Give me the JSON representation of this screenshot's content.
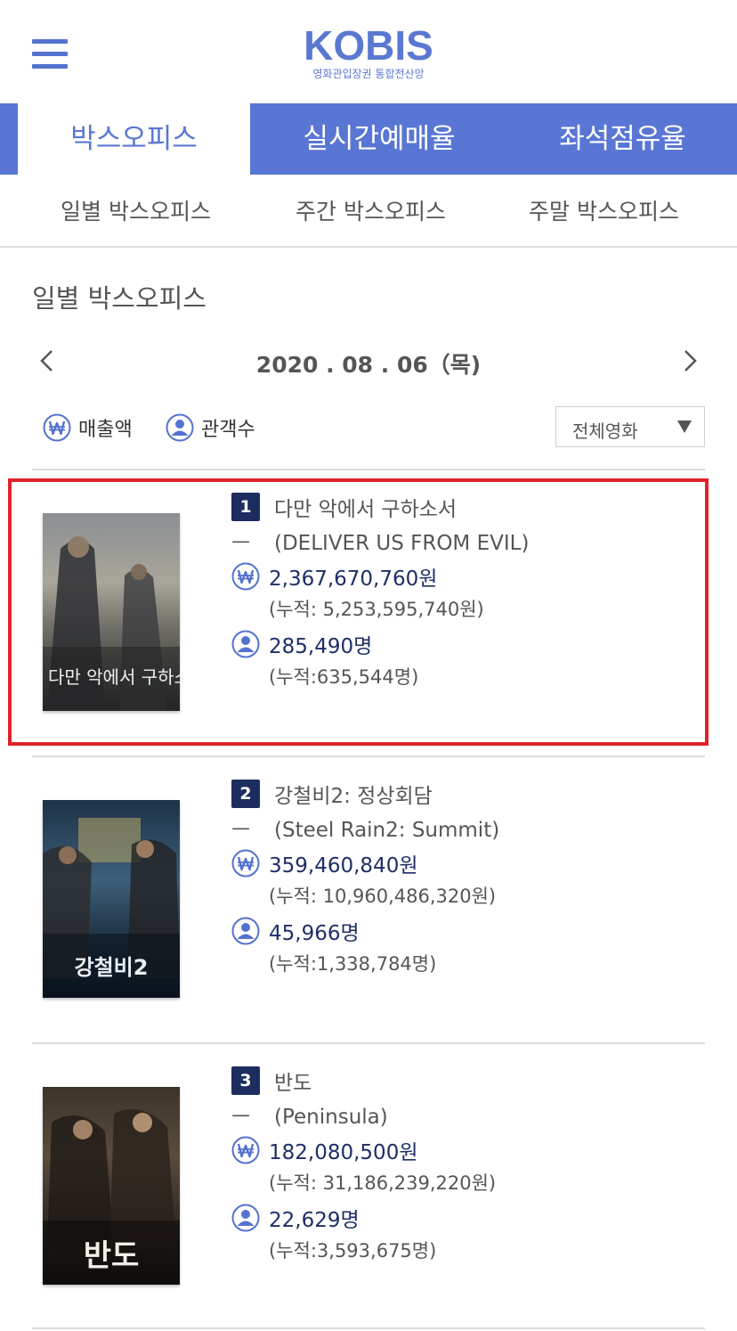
{
  "header": {
    "logo_title": "KOBIS",
    "logo_subtitle": "영화관입장권 통합전산망",
    "menu_icon": "hamburger-menu-icon"
  },
  "main_tabs": [
    {
      "label": "박스오피스",
      "active": true
    },
    {
      "label": "실시간예매율",
      "active": false
    },
    {
      "label": "좌석점유율",
      "active": false
    }
  ],
  "sub_tabs": [
    {
      "label": "일별 박스오피스"
    },
    {
      "label": "주간 박스오피스"
    },
    {
      "label": "주말 박스오피스"
    }
  ],
  "section_title": "일별 박스오피스",
  "date_nav": {
    "date": "2020 . 08 . 06（목)",
    "prev_icon": "chevron-left-icon",
    "next_icon": "chevron-right-icon"
  },
  "toggles": {
    "sales_label": "매출액",
    "audience_label": "관객수"
  },
  "filter": {
    "selected": "전체영화"
  },
  "colors": {
    "brand": "#5976d4",
    "navy": "#1d2d5f",
    "highlight": "#e0222a"
  },
  "movies": [
    {
      "rank": "1",
      "title_ko": "다만 악에서 구하소서",
      "dash": "ㅡ",
      "title_en": "(DELIVER US FROM EVIL)",
      "sales": "2,367,670,760원",
      "sales_cum": "(누적: 5,253,595,740원)",
      "audience": "285,490명",
      "audience_cum": "(누적:635,544명)",
      "poster_text": "다만 악에서 구하소서"
    },
    {
      "rank": "2",
      "title_ko": "강철비2: 정상회담",
      "dash": "ㅡ",
      "title_en": "(Steel Rain2: Summit)",
      "sales": "359,460,840원",
      "sales_cum": "(누적: 10,960,486,320원)",
      "audience": "45,966명",
      "audience_cum": "(누적:1,338,784명)",
      "poster_text": "강철비2"
    },
    {
      "rank": "3",
      "title_ko": "반도",
      "dash": "ㅡ",
      "title_en": "(Peninsula)",
      "sales": "182,080,500원",
      "sales_cum": "(누적: 31,186,239,220원)",
      "audience": "22,629명",
      "audience_cum": "(누적:3,593,675명)",
      "poster_text": "반도"
    }
  ]
}
